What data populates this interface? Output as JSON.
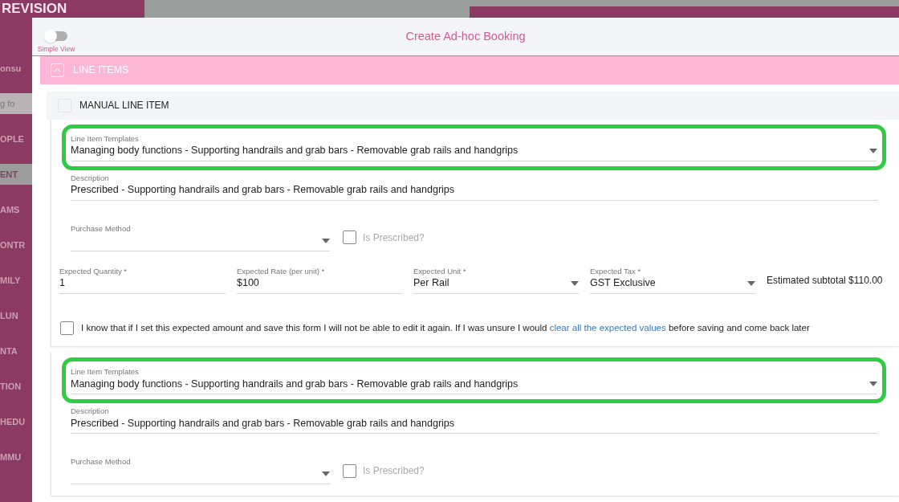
{
  "background": {
    "logo": "REVISION",
    "sidebar_items": [
      {
        "label": "onsu",
        "kind": "text",
        "selected": false
      },
      {
        "label": "g fo",
        "kind": "search",
        "selected": false
      },
      {
        "label": "OPLE",
        "kind": "text",
        "selected": false
      },
      {
        "label": "ENT",
        "kind": "text",
        "selected": true
      },
      {
        "label": "AMS",
        "kind": "text",
        "selected": false
      },
      {
        "label": "ONTR",
        "kind": "text",
        "selected": false
      },
      {
        "label": "MILY",
        "kind": "text",
        "selected": false
      },
      {
        "label": "LUN",
        "kind": "text",
        "selected": false
      },
      {
        "label": "NTA",
        "kind": "text",
        "selected": false
      },
      {
        "label": "TION",
        "kind": "text",
        "selected": false
      },
      {
        "label": "HEDU",
        "kind": "text",
        "selected": false
      },
      {
        "label": "MMU",
        "kind": "text",
        "selected": false
      }
    ]
  },
  "dialog": {
    "title": "Create Ad-hoc Booking",
    "simple_view": {
      "label": "Simple View",
      "on": false
    },
    "section": {
      "label": "LINE ITEMS",
      "expanded": true
    },
    "manual_line_item": {
      "label": "MANUAL LINE ITEM",
      "checked": false
    },
    "line_items": [
      {
        "template": {
          "label": "Line Item Templates",
          "value": "Managing body functions - Supporting handrails and grab bars - Removable grab rails and handgrips",
          "highlighted": true
        },
        "description": {
          "label": "Description",
          "value": "Prescribed - Supporting handrails and grab bars - Removable grab rails and handgrips"
        },
        "purchase_method": {
          "label": "Purchase Method"
        },
        "is_prescribed": {
          "label": "Is Prescribed?",
          "checked": false
        },
        "expected": {
          "quantity": {
            "label": "Expected Quantity *",
            "value": "1"
          },
          "rate": {
            "label": "Expected Rate (per unit) *",
            "value": "$100"
          },
          "unit": {
            "label": "Expected Unit *",
            "value": "Per Rail"
          },
          "tax": {
            "label": "Expected Tax *",
            "value": "GST Exclusive"
          },
          "subtotal": "Estimated subtotal $110.00"
        },
        "acknowledgement": {
          "checked": false,
          "text": "I know that if I set this expected amount and save this form I will not be able to edit it again. If I was unsure I would",
          "link": "clear all the expected values",
          "text_after": "before saving and come back later"
        }
      },
      {
        "template": {
          "label": "Line Item Templates",
          "value": "Managing body functions - Supporting handrails and grab bars - Removable grab rails and handgrips",
          "highlighted": true
        },
        "description": {
          "label": "Description",
          "value": "Prescribed - Supporting handrails and grab bars - Removable grab rails and handgrips"
        },
        "purchase_method": {
          "label": "Purchase Method"
        },
        "is_prescribed": {
          "label": "Is Prescribed?",
          "checked": false
        }
      }
    ]
  }
}
